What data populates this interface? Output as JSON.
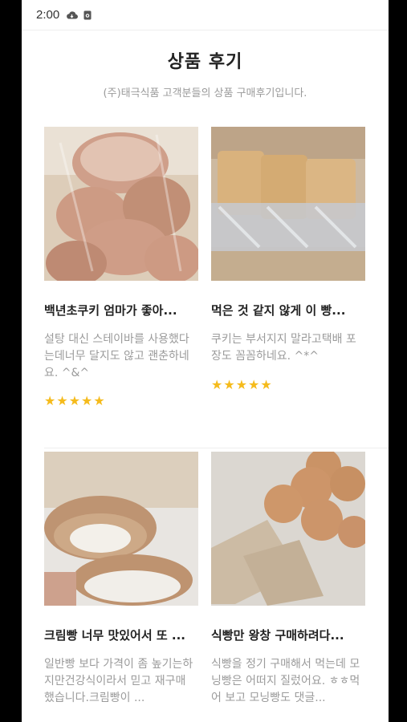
{
  "status_bar": {
    "time": "2:00"
  },
  "header": {
    "title": "상품 후기",
    "subtitle": "(주)태극식품 고객분들의 상품 구매후기입니다."
  },
  "reviews": [
    {
      "title": "백년초쿠키 엄마가 좋아...",
      "text": "설탕 대신 스테이바를 사용했다는데너무 달지도 않고 괜춘하네요. ^&^",
      "stars": "★★★★★",
      "rating": 5
    },
    {
      "title": "먹은 것 같지 않게 이 빵...",
      "text": " 쿠키는 부서지지 말라고택배 포장도 꼼꼼하네요. ^*^",
      "stars": "★★★★★",
      "rating": 5
    },
    {
      "title": "크림빵 너무 맛있어서 또 ...",
      "text": "일반빵 보다 가격이 좀 높기는하지만건강식이라서 믿고 재구매 했습니다.크림빵이 ...",
      "stars": "",
      "rating": null
    },
    {
      "title": "식빵만 왕창 구매하려다...",
      "text": "식빵을 정기 구매해서 먹는데 모닝빵은 어떠지 질렀어요. ㅎㅎ먹어 보고 모닝빵도 댓글...",
      "stars": "",
      "rating": null
    }
  ],
  "colors": {
    "star": "#f5bb1c",
    "muted_text": "#9b9b9b",
    "title_text": "#222222"
  }
}
